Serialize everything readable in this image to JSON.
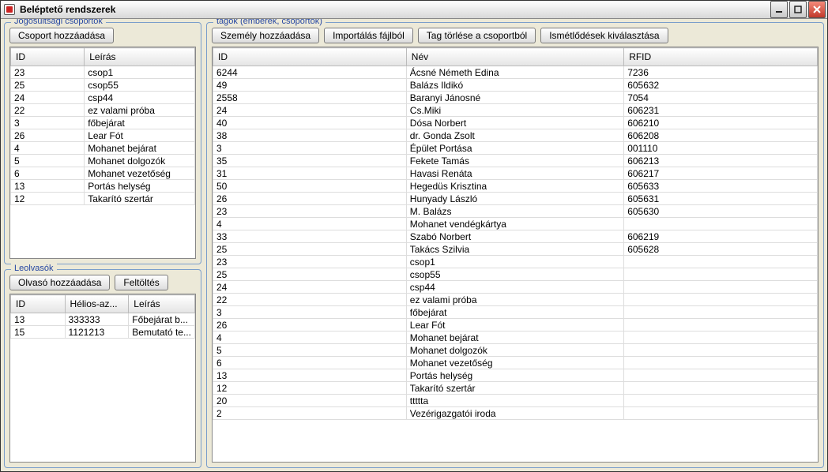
{
  "window": {
    "title": "Beléptető rendszerek"
  },
  "groups": {
    "legend": "Jogosultsági csoportok",
    "button_add": "Csoport hozzáadása",
    "columns": [
      "ID",
      "Leírás"
    ],
    "rows": [
      {
        "id": "23",
        "desc": "csop1"
      },
      {
        "id": "25",
        "desc": "csop55"
      },
      {
        "id": "24",
        "desc": "csp44"
      },
      {
        "id": "22",
        "desc": "ez valami próba"
      },
      {
        "id": "3",
        "desc": "főbejárat"
      },
      {
        "id": "26",
        "desc": "Lear Fót"
      },
      {
        "id": "4",
        "desc": "Mohanet bejárat"
      },
      {
        "id": "5",
        "desc": "Mohanet dolgozók"
      },
      {
        "id": "6",
        "desc": "Mohanet vezetőség"
      },
      {
        "id": "13",
        "desc": "Portás helység"
      },
      {
        "id": "12",
        "desc": "Takarító szertár"
      }
    ]
  },
  "readers": {
    "legend": "Leolvasók",
    "button_add": "Olvasó hozzáadása",
    "button_upload": "Feltöltés",
    "columns": [
      "ID",
      "Hélios-az...",
      "Leírás"
    ],
    "rows": [
      {
        "id": "13",
        "helios": "333333",
        "desc": "Főbejárat b..."
      },
      {
        "id": "15",
        "helios": "1121213",
        "desc": "Bemutató te..."
      }
    ]
  },
  "members": {
    "legend": "tagok (emberek, csoportok)",
    "button_add_person": "Személy hozzáadása",
    "button_import": "Importálás fájlból",
    "button_delete": "Tag törlése a csoportból",
    "button_dupes": "Ismétlődések kiválasztása",
    "columns": [
      "ID",
      "Név",
      "RFID"
    ],
    "rows": [
      {
        "id": "6244",
        "name": "Ácsné Németh Edina",
        "rfid": "7236"
      },
      {
        "id": "49",
        "name": "Balázs Ildikó",
        "rfid": "605632"
      },
      {
        "id": "2558",
        "name": "Baranyi Jánosné",
        "rfid": "7054"
      },
      {
        "id": "24",
        "name": "Cs.Miki",
        "rfid": "606231"
      },
      {
        "id": "40",
        "name": "Dósa Norbert",
        "rfid": "606210"
      },
      {
        "id": "38",
        "name": "dr. Gonda Zsolt",
        "rfid": "606208"
      },
      {
        "id": "3",
        "name": "Épület Portása",
        "rfid": "001110"
      },
      {
        "id": "35",
        "name": "Fekete Tamás",
        "rfid": "606213"
      },
      {
        "id": "31",
        "name": "Havasi Renáta",
        "rfid": "606217"
      },
      {
        "id": "50",
        "name": "Hegedüs Krisztina",
        "rfid": "605633"
      },
      {
        "id": "26",
        "name": "Hunyady László",
        "rfid": "605631"
      },
      {
        "id": "23",
        "name": "M. Balázs",
        "rfid": "605630"
      },
      {
        "id": "4",
        "name": "Mohanet vendégkártya",
        "rfid": ""
      },
      {
        "id": "33",
        "name": "Szabó Norbert",
        "rfid": "606219"
      },
      {
        "id": "25",
        "name": "Takács Szilvia",
        "rfid": "605628"
      },
      {
        "id": "23",
        "name": "csop1",
        "rfid": ""
      },
      {
        "id": "25",
        "name": "csop55",
        "rfid": ""
      },
      {
        "id": "24",
        "name": "csp44",
        "rfid": ""
      },
      {
        "id": "22",
        "name": "ez valami próba",
        "rfid": ""
      },
      {
        "id": "3",
        "name": "főbejárat",
        "rfid": ""
      },
      {
        "id": "26",
        "name": "Lear Fót",
        "rfid": ""
      },
      {
        "id": "4",
        "name": "Mohanet bejárat",
        "rfid": ""
      },
      {
        "id": "5",
        "name": "Mohanet dolgozók",
        "rfid": ""
      },
      {
        "id": "6",
        "name": "Mohanet vezetőség",
        "rfid": ""
      },
      {
        "id": "13",
        "name": "Portás helység",
        "rfid": ""
      },
      {
        "id": "12",
        "name": "Takarító szertár",
        "rfid": ""
      },
      {
        "id": "20",
        "name": "ttttta",
        "rfid": ""
      },
      {
        "id": "2",
        "name": "Vezérigazgatói iroda",
        "rfid": ""
      }
    ]
  }
}
